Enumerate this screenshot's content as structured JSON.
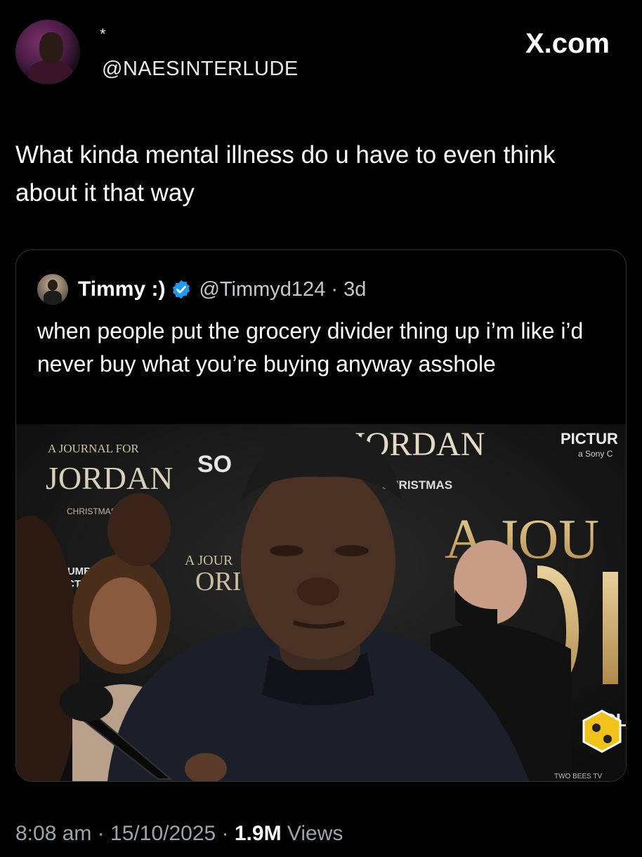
{
  "header": {
    "display_name": "*",
    "handle": "@NAESINTERLUDE",
    "site_mark": "X.com"
  },
  "tweet": {
    "text": "What kinda mental illness do u have to even think about it that way"
  },
  "quoted_tweet": {
    "name": "Timmy :)",
    "handle_meta": "@Timmyd124 · 3d",
    "text": "when people put the grocery divider thing up i’m like i’d never buy what you’re buying anyway asshole",
    "image": {
      "backdrop_texts": {
        "left_journal": "A JOURNAL FOR",
        "left_jordan": "JORDAN",
        "left_christmas": "CHRISTMAS",
        "so": "SO",
        "center_jordan": "JORDAN",
        "center_christmas": "CHRISTMAS",
        "pictures": "PICTUR",
        "sony": "a Sony C",
        "big_jou": "A JOU",
        "small_jour": "A JOUR",
        "small_ord": "ORI",
        "columbia": "OLUMB",
        "pictu": "PICTU",
        "cl": "CL",
        "watermark": "TWO BEES TV"
      }
    }
  },
  "footer": {
    "time_date": "8:08 am · 15/10/2025 · ",
    "views_count": "1.9M",
    "views_label": " Views"
  },
  "colors": {
    "background": "#000000",
    "text": "#ffffff",
    "muted": "#9ea3a8",
    "border": "#2f3336",
    "verified": "#1d9bf0"
  }
}
